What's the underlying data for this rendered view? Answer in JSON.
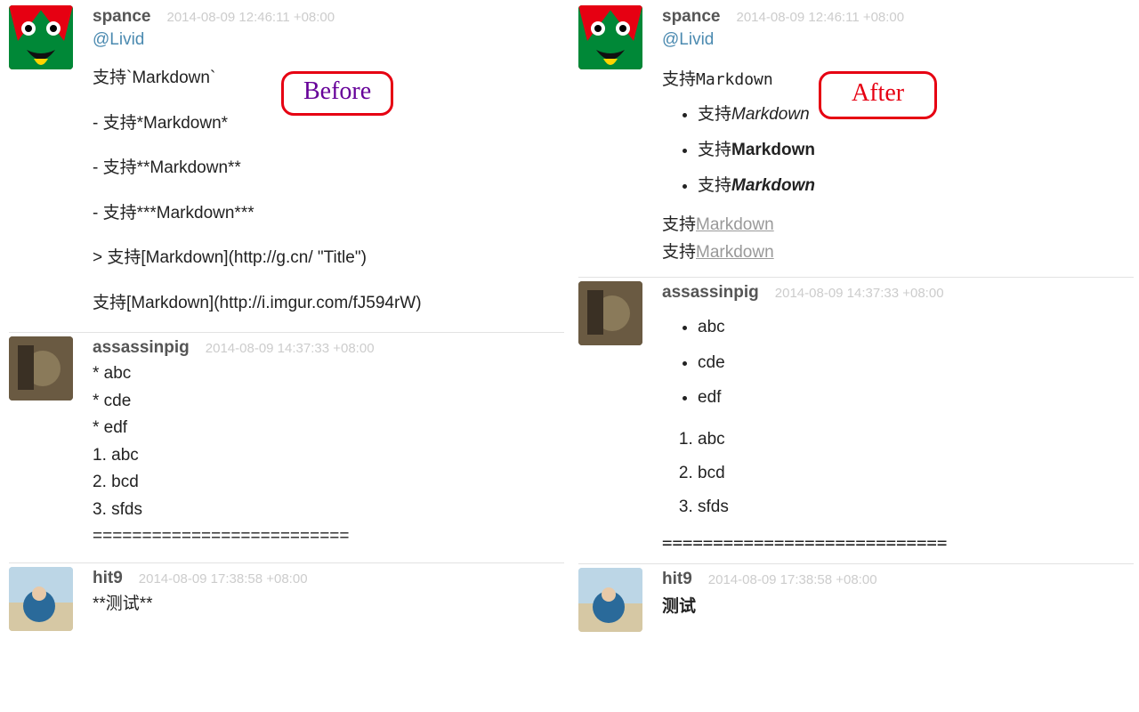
{
  "labels": {
    "before": "Before",
    "after": "After"
  },
  "left": {
    "posts": [
      {
        "user": "spance",
        "ts": "2014-08-09 12:46:11 +08:00",
        "mention": "@Livid",
        "lines": [
          "支持`Markdown`",
          "- 支持*Markdown*",
          "- 支持**Markdown**",
          "- 支持***Markdown***",
          "> 支持[Markdown](http://g.cn/ \"Title\")",
          "支持[Markdown](http://i.imgur.com/fJ594rW)"
        ]
      },
      {
        "user": "assassinpig",
        "ts": "2014-08-09 14:37:33 +08:00",
        "lines": [
          "* abc",
          "* cde",
          "* edf",
          "1. abc",
          "2. bcd",
          "3. sfds",
          "=========================="
        ]
      },
      {
        "user": "hit9",
        "ts": "2014-08-09 17:38:58 +08:00",
        "lines": [
          "**测试**"
        ]
      }
    ]
  },
  "right": {
    "posts": [
      {
        "user": "spance",
        "ts": "2014-08-09 12:46:11 +08:00",
        "mention": "@Livid",
        "top_line_pre": "支持",
        "top_line_code": "Markdown",
        "bullets": [
          {
            "pre": "支持",
            "md": "Markdown",
            "style": "ital"
          },
          {
            "pre": "支持",
            "md": "Markdown",
            "style": "bold"
          },
          {
            "pre": "支持",
            "md": "Markdown",
            "style": "boldital"
          }
        ],
        "indent_pre": "支持",
        "indent_link": "Markdown",
        "bottom_pre": "支持",
        "bottom_link": "Markdown"
      },
      {
        "user": "assassinpig",
        "ts": "2014-08-09 14:37:33 +08:00",
        "ul": [
          "abc",
          "cde",
          "edf"
        ],
        "ol": [
          "abc",
          "bcd",
          "sfds"
        ],
        "eq": "============================"
      },
      {
        "user": "hit9",
        "ts": "2014-08-09 17:38:58 +08:00",
        "bold_line": "测试"
      }
    ]
  }
}
